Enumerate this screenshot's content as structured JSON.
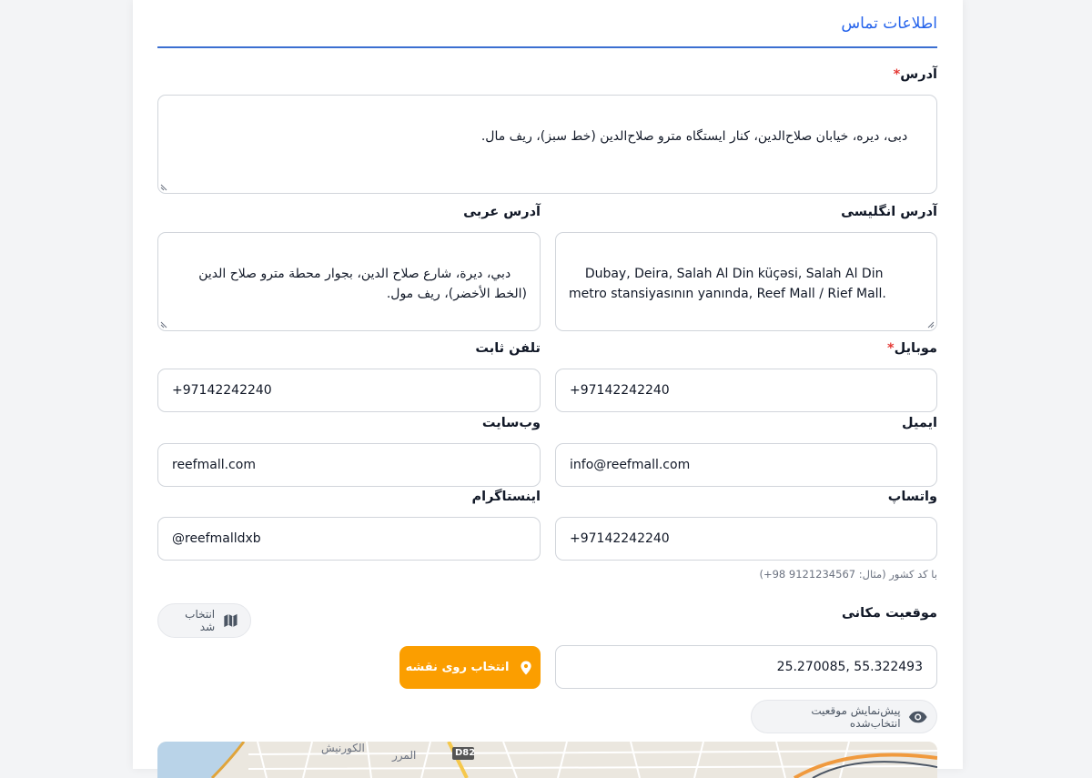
{
  "section": {
    "title": "اطلاعات تماس"
  },
  "address": {
    "label": "آدرس",
    "required_mark": "*",
    "value": "دبی، دیره، خیابان صلاح‌الدین، کنار ایستگاه مترو صلاح‌الدین (خط سبز)، ریف مال."
  },
  "address_en": {
    "label": "آدرس انگلیسی",
    "value": "Dubay, Deira, Salah Al Din küçəsi, Salah Al Din metro stansiyasının yanında, Reef Mall / Rief Mall."
  },
  "address_ar": {
    "label": "آدرس عربی",
    "value": "دبي، ديرة، شارع صلاح الدين، بجوار محطة مترو صلاح الدين (الخط الأخضر)، ريف مول."
  },
  "mobile": {
    "label": "موبایل",
    "required_mark": "*",
    "value": "+97142242240"
  },
  "landline": {
    "label": "تلفن ثابت",
    "value": "+97142242240"
  },
  "email": {
    "label": "ایمیل",
    "value": "info@reefmall.com"
  },
  "website": {
    "label": "وب‌سایت",
    "value": "reefmall.com"
  },
  "whatsapp": {
    "label": "واتساپ",
    "value": "+97142242240",
    "hint": "با کد کشور (مثال: ‎+98 9121234567)"
  },
  "instagram": {
    "label": "اینستاگرام",
    "value": "@reefmalldxb"
  },
  "location": {
    "label": "موقعیت مکانی",
    "status_chip": "انتخاب شد",
    "coordinates": "25.270085, 55.322493",
    "map_button": "انتخاب روی نقشه",
    "preview_button": "پیش‌نمایش موقعیت انتخاب‌شده"
  },
  "map": {
    "labels": [
      "الكورنيش",
      "المرر",
      "D82"
    ]
  },
  "colors": {
    "accent": "#2563eb",
    "orange": "#fb9e00",
    "required": "#e53935"
  }
}
